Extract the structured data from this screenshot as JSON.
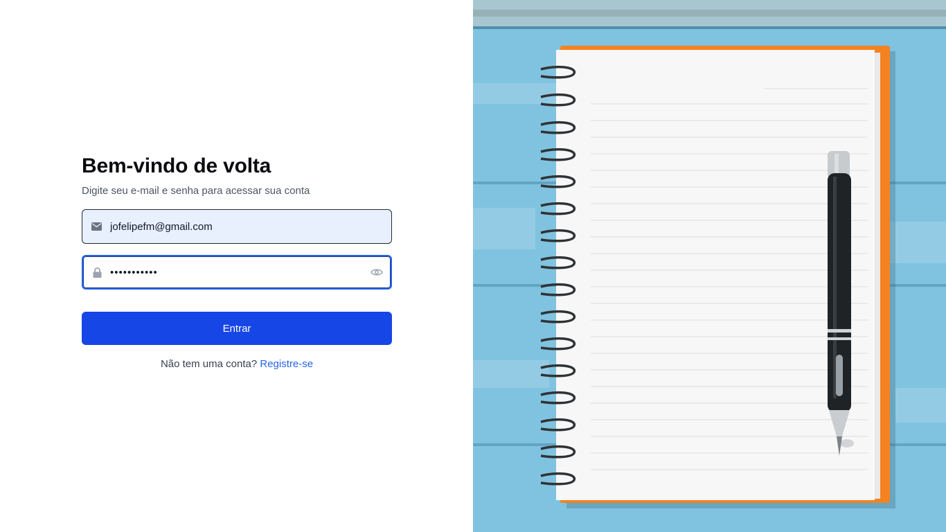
{
  "login": {
    "title": "Bem-vindo de volta",
    "subtitle": "Digite seu e-mail e senha para acessar sua conta",
    "email_value": "jofelipefm@gmail.com",
    "password_value": "•••••••••••",
    "submit_label": "Entrar",
    "register_prompt": "Não tem uma conta?",
    "register_link": "Registre-se"
  },
  "icons": {
    "email": "envelope-icon",
    "password": "lock-icon",
    "toggle": "eye-icon"
  },
  "colors": {
    "primary": "#1746e6",
    "link": "#2563eb",
    "email_field_bg": "#e8effd",
    "notebook_cover": "#f58220",
    "wood_blue": "#7cc1df"
  }
}
